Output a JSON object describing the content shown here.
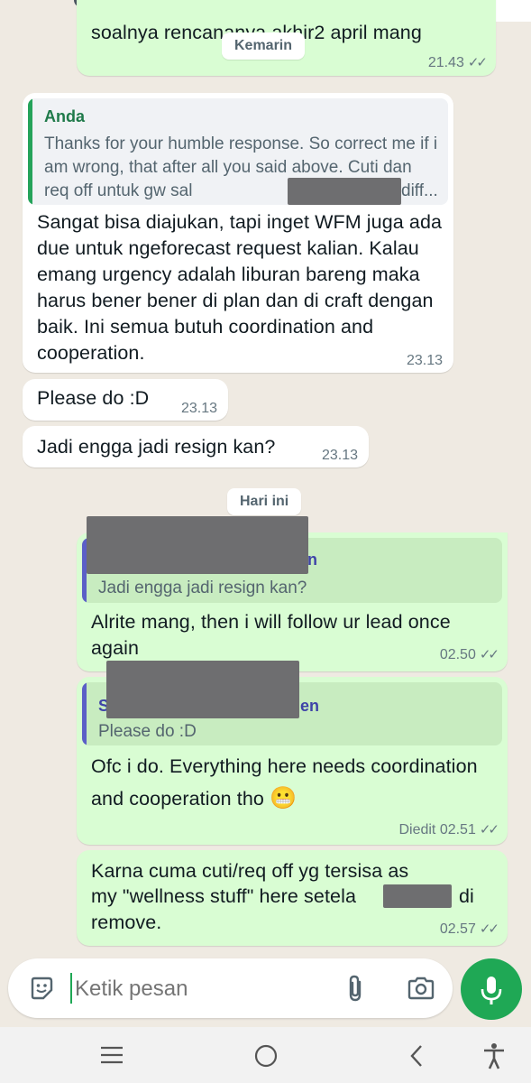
{
  "chat": {
    "top_message": {
      "text": "soalnya rencananya akhir2 april mang",
      "time": "21.43"
    },
    "date_yesterday": "Kemarin",
    "msg1": {
      "quote_sender": "Anda",
      "quote_text": "Thanks for your humble response. So correct me if i am wrong, that after all you said above. Cuti dan req off untuk gw sal",
      "quote_tail": "diff...",
      "text": "Sangat bisa diajukan, tapi inget WFM juga ada due untuk ngeforecast request kalian. Kalau emang urgency adalah liburan bareng maka harus bener bener di plan dan di craft dengan baik. Ini semua butuh coordination and cooperation.",
      "time": "23.13"
    },
    "msg2": {
      "text": "Please do :D",
      "time": "23.13"
    },
    "msg3": {
      "text": "Jadi engga jadi resign kan?",
      "time": "23.13"
    },
    "date_today": "Hari ini",
    "msg4": {
      "quote_sender_tail": "n",
      "quote_text": "Jadi engga jadi resign kan?",
      "text": "Alrite mang, then i will follow ur lead once again",
      "time": "02.50"
    },
    "msg5": {
      "quote_sender_head": "S",
      "quote_sender_tail": "en",
      "quote_text": "Please do :D",
      "text": "Ofc i do. Everything here needs coordination and cooperation tho",
      "emoji": "😬",
      "edited_label": "Diedit",
      "time": "02.51"
    },
    "msg6": {
      "text_line1": "Karna cuma cuti/req off yg tersisa as",
      "text_line2a": "my \"wellness stuff\" here setela",
      "text_line2b": "di",
      "text_line3": "remove.",
      "time": "02.57"
    }
  },
  "composer": {
    "placeholder": "Ketik pesan"
  },
  "icons": {
    "sticker": "sticker-icon",
    "attach": "paperclip-icon",
    "camera": "camera-icon",
    "mic": "mic-icon"
  },
  "colors": {
    "outgoing": "#d9fdd3",
    "incoming": "#ffffff",
    "background": "#efeae2",
    "accent": "#1fa855",
    "quote_bar_in": "#25a35a",
    "quote_bar_out": "#5b5fc7"
  }
}
